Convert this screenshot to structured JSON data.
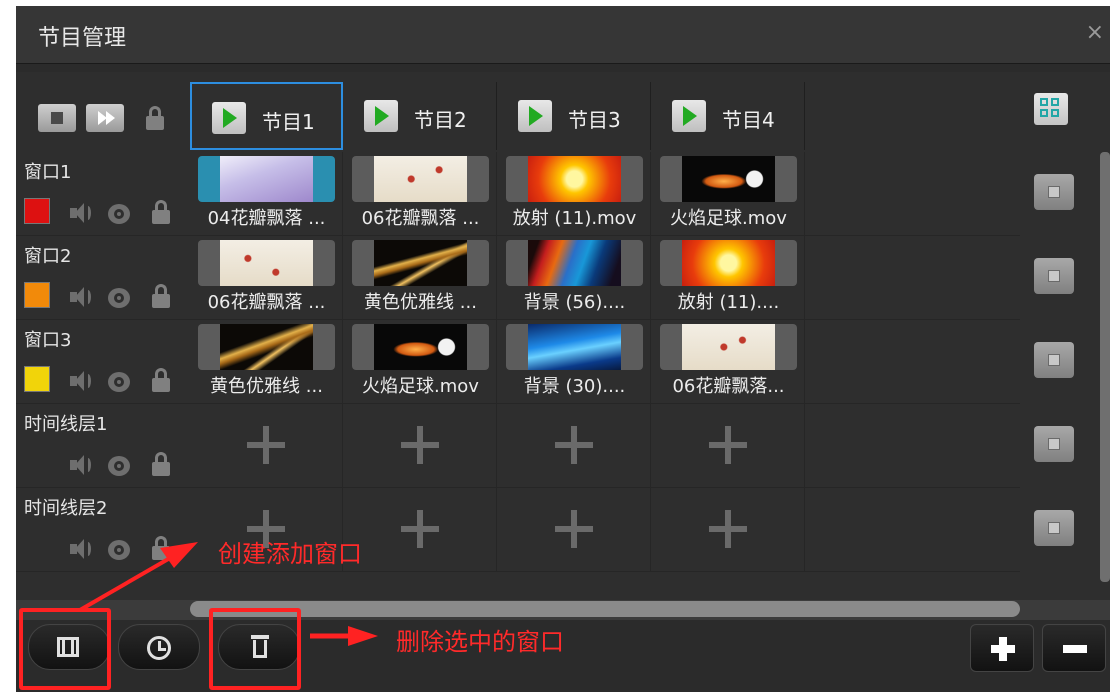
{
  "window": {
    "title": "节目管理",
    "close": "×"
  },
  "programs": [
    {
      "label": "节目1",
      "selected": true
    },
    {
      "label": "节目2",
      "selected": false
    },
    {
      "label": "节目3",
      "selected": false
    },
    {
      "label": "节目4",
      "selected": false
    }
  ],
  "layers": [
    {
      "label": "窗口1",
      "color": "#dd1111",
      "clips": [
        "04花瓣飘落 ...",
        "06花瓣飘落 ...",
        "放射 (11).mov",
        "火焰足球.mov"
      ]
    },
    {
      "label": "窗口2",
      "color": "#f28a0a",
      "clips": [
        "06花瓣飘落 ...",
        "黄色优雅线 ...",
        "背景 (56)....",
        "放射 (11)...."
      ]
    },
    {
      "label": "窗口3",
      "color": "#f1d40a",
      "clips": [
        "黄色优雅线 ...",
        "火焰足球.mov",
        "背景 (30)....",
        "06花瓣飘落..."
      ]
    },
    {
      "label": "时间线层1"
    },
    {
      "label": "时间线层2"
    }
  ],
  "annotations": {
    "create_window": "创建添加窗口",
    "delete_window": "删除选中的窗口"
  },
  "colors": {
    "annotation_red": "#ff2222",
    "selection_blue": "#2d8ee0",
    "play_green": "#22aa22"
  }
}
